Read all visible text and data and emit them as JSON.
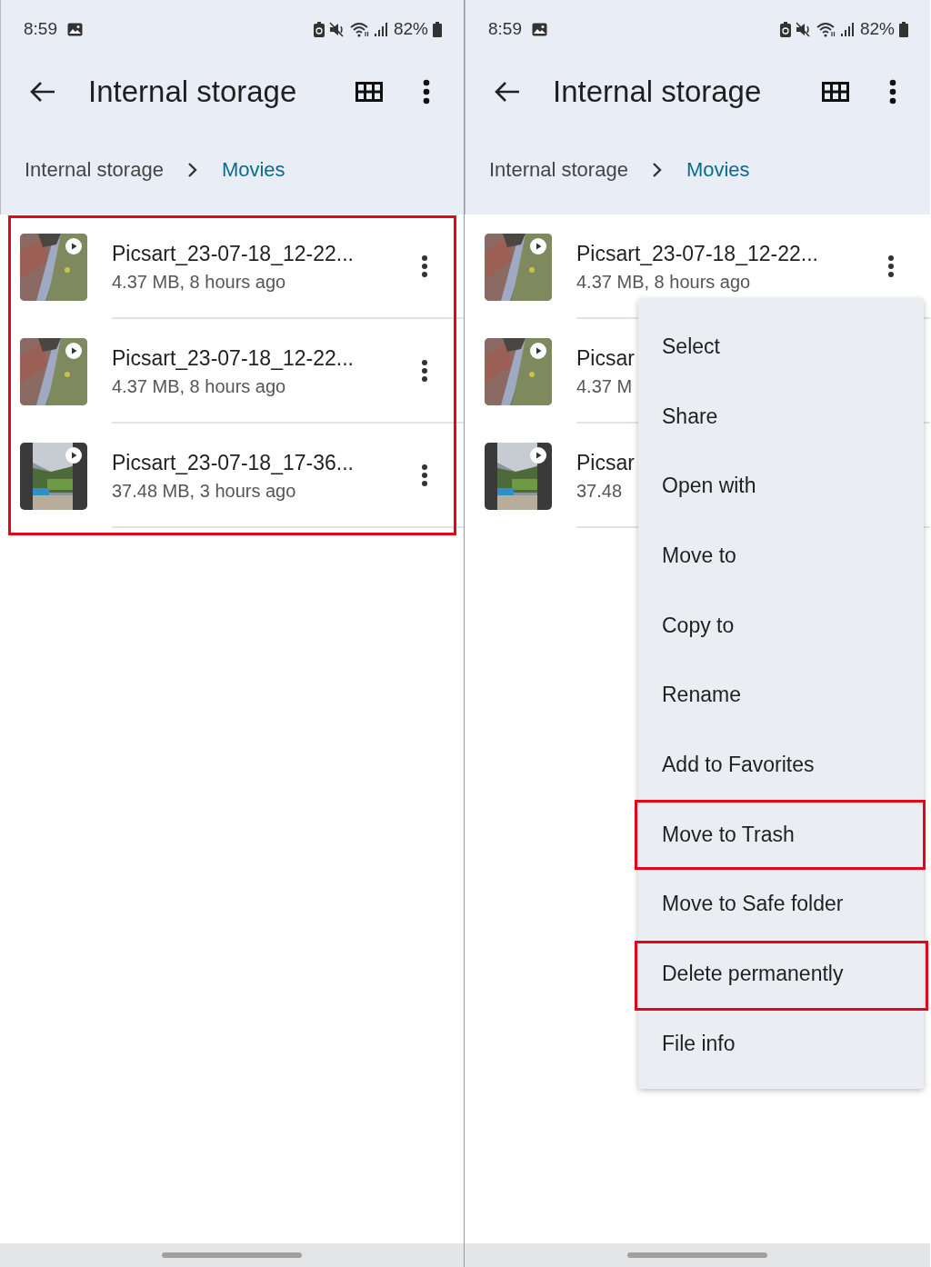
{
  "screens": [
    {
      "status_bar": {
        "time": "8:59",
        "battery": "82%"
      },
      "app_bar": {
        "title": "Internal storage"
      },
      "breadcrumb": [
        {
          "label": "Internal storage",
          "current": false
        },
        {
          "label": "Movies",
          "current": true
        }
      ],
      "files_highlighted": true,
      "files": [
        {
          "name": "Picsart_23-07-18_12-22...",
          "meta": "4.37 MB, 8 hours ago",
          "kind": "aerial"
        },
        {
          "name": "Picsart_23-07-18_12-22...",
          "meta": "4.37 MB, 8 hours ago",
          "kind": "aerial"
        },
        {
          "name": "Picsart_23-07-18_17-36...",
          "meta": "37.48 MB, 3 hours ago",
          "kind": "portrait"
        }
      ]
    },
    {
      "status_bar": {
        "time": "8:59",
        "battery": "82%"
      },
      "app_bar": {
        "title": "Internal storage"
      },
      "breadcrumb": [
        {
          "label": "Internal storage",
          "current": false
        },
        {
          "label": "Movies",
          "current": true
        }
      ],
      "files_highlighted": false,
      "files": [
        {
          "name": "Picsart_23-07-18_12-22...",
          "meta": "4.37 MB, 8 hours ago",
          "kind": "aerial"
        },
        {
          "name": "Picsar",
          "meta": "4.37 M",
          "kind": "aerial",
          "menu_covered": true
        },
        {
          "name": "Picsar",
          "meta": "37.48",
          "kind": "portrait",
          "menu_covered": true
        }
      ],
      "menu": {
        "items": [
          {
            "label": "Select",
            "highlighted": false
          },
          {
            "label": "Share",
            "highlighted": false
          },
          {
            "label": "Open with",
            "highlighted": false
          },
          {
            "label": "Move to",
            "highlighted": false
          },
          {
            "label": "Copy to",
            "highlighted": false
          },
          {
            "label": "Rename",
            "highlighted": false
          },
          {
            "label": "Add to Favorites",
            "highlighted": false
          },
          {
            "label": "Move to Trash",
            "highlighted": true
          },
          {
            "label": "Move to Safe folder",
            "highlighted": false
          },
          {
            "label": "Delete permanently",
            "highlighted": true
          },
          {
            "label": "File info",
            "highlighted": false
          }
        ]
      }
    }
  ]
}
